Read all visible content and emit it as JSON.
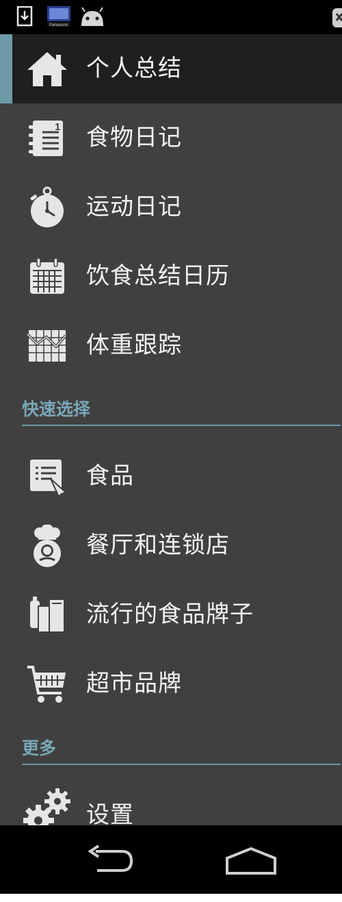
{
  "status_bar": {
    "icons": [
      "download-icon",
      "panasonic-icon",
      "android-icon",
      "close-icon"
    ],
    "panasonic_text": "Panasonic"
  },
  "drawer": {
    "primary_items": [
      {
        "label": "个人总结",
        "icon": "home-icon",
        "active": true
      },
      {
        "label": "食物日记",
        "icon": "notebook-icon",
        "active": false
      },
      {
        "label": "运动日记",
        "icon": "stopwatch-icon",
        "active": false
      },
      {
        "label": "饮食总结日历",
        "icon": "calendar-icon",
        "active": false
      },
      {
        "label": "体重跟踪",
        "icon": "weight-chart-icon",
        "active": false
      }
    ],
    "quick_section": {
      "title": "快速选择",
      "items": [
        {
          "label": "食品",
          "icon": "food-list-icon"
        },
        {
          "label": "餐厅和连锁店",
          "icon": "chef-icon"
        },
        {
          "label": "流行的食品牌子",
          "icon": "grocery-bag-icon"
        },
        {
          "label": "超市品牌",
          "icon": "shopping-cart-icon"
        }
      ]
    },
    "more_section": {
      "title": "更多",
      "items": [
        {
          "label": "设置",
          "icon": "gears-icon"
        }
      ]
    }
  },
  "nav_bar": {
    "icons": [
      "back-icon",
      "home-outline-icon"
    ]
  },
  "colors": {
    "drawer_bg": "#404040",
    "active_bg": "#1f1f1f",
    "accent": "#6e9aa7",
    "section_text": "#7aa6b6"
  }
}
